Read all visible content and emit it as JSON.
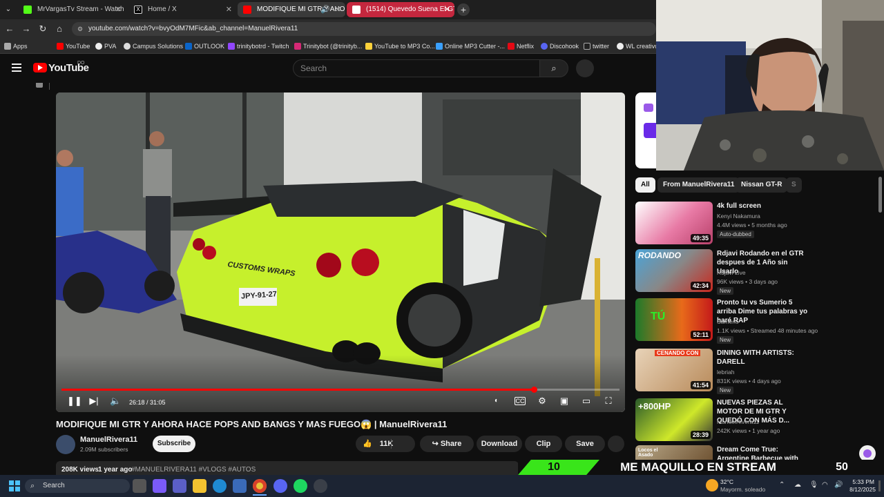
{
  "browser": {
    "tabs": [
      {
        "title": "MrVargasTv Stream - Watch Li",
        "fav_color": "#53fc18"
      },
      {
        "title": "Home / X",
        "fav_color": "#e7e7e7"
      },
      {
        "title": "MODIFIQUE MI GTR Y AHO",
        "fav_color": "#ff0000"
      },
      {
        "title": "(1514) Quevedo Suena El GTI",
        "fav_color": "#ff0000"
      }
    ],
    "url": "youtube.com/watch?v=bvyOdM7MFic&ab_channel=ManuelRivera11",
    "bookmarks": [
      "Apps",
      "YouTube",
      "PVA",
      "Campus Solutions",
      "OUTLOOK",
      "trinitybotrd - Twitch",
      "Trinitybot (@trinityb...",
      "YouTube to MP3 Co...",
      "Online MP3 Cutter -...",
      "Netflix",
      "Discohook",
      "twitter",
      "WL creativo"
    ]
  },
  "youtube": {
    "logo": "YouTube",
    "logo_sup": "DO",
    "search_placeholder": "Search",
    "player": {
      "time": "26:18 / 31:05",
      "progress_percent": 84.6,
      "plate": "JPY-91-27",
      "car_text": "CUSTOMS WRAPS"
    },
    "video_title": "MODIFIQUE MI GTR Y AHORA HACE POPS AND BANGS Y MAS FUEGO😱 | ManuelRivera11",
    "channel": {
      "name": "ManuelRivera11",
      "subscribers": "2.09M subscribers",
      "subscribe_label": "Subscribe"
    },
    "actions": {
      "likes": "11K",
      "share": "Share",
      "download": "Download",
      "clip": "Clip",
      "save": "Save"
    },
    "description": {
      "views": "208K views",
      "age": "1 year ago",
      "tags": "#MANUELRIVERA11 #VLOGS #AUTOS"
    },
    "chips": [
      "All",
      "From ManuelRivera11",
      "Nissan GT-R",
      "S"
    ],
    "recommendations": [
      {
        "title": "4k full screen",
        "channel": "Kenyi Nakamura",
        "meta": "4.4M views • 5 months ago",
        "badge": "Auto-dubbed",
        "duration": "49:35",
        "color": "#c75a86"
      },
      {
        "title": "Rdjavi Rodando en el GTR despues de 1 Año sin Usarlo",
        "channel": "Rdjavi Live",
        "meta": "96K views • 3 days ago",
        "badge": "New",
        "duration": "42:34",
        "color": "#b3272a",
        "thumb_text": "RODANDO"
      },
      {
        "title": "Pronto tu vs Sumerio 5 arriba Dime tus palabras yo haré RAP",
        "channel": "Sumerio",
        "meta": "1.1K views • Streamed 48 minutes ago",
        "badge": "New",
        "duration": "52:11",
        "color": "#d4421a",
        "thumb_text": "TÚ"
      },
      {
        "title": "DINING WITH ARTISTS: DARELL",
        "channel": "lebriah",
        "meta": "831K views • 4 days ago",
        "badge": "New",
        "duration": "41:54",
        "color": "#b88a5a",
        "thumb_text": "CENANDO CON"
      },
      {
        "title": "NUEVAS PIEZAS AL MOTOR DE MI GTR Y QUEDÓ CON MÁS D...",
        "channel": "ManuelRivera11",
        "meta": "242K views • 1 year ago",
        "badge": "",
        "duration": "28:39",
        "color": "#3a7a3a",
        "thumb_text": "+800HP"
      },
      {
        "title": "Dream Come True: Argentine Barbecue with Oscar from ...",
        "channel": "",
        "meta": "",
        "badge": "",
        "duration": "",
        "color": "#6b4a2a",
        "thumb_text": "Locos el Asado"
      }
    ]
  },
  "overlay": {
    "left_number": "10",
    "text": "ME MAQUILLO EN STREAM",
    "right_number": "50",
    "accent": "#39e51a"
  },
  "taskbar": {
    "search": "Search",
    "weather_temp": "32°C",
    "weather_desc": "Mayorm. soleado",
    "time": "5:33 PM",
    "date": "8/12/2025"
  }
}
